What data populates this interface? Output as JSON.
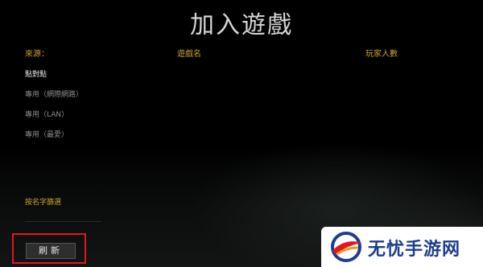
{
  "page": {
    "title": "加入遊戲"
  },
  "columns": {
    "source": "來源：",
    "game_name": "遊戲名",
    "players": "玩家人數"
  },
  "sources": [
    {
      "label": "點對點",
      "active": true
    },
    {
      "label": "專用（網際網路）",
      "active": false
    },
    {
      "label": "專用（LAN）",
      "active": false
    },
    {
      "label": "專用（最愛）",
      "active": false
    }
  ],
  "sort": {
    "label": "按名字篩選"
  },
  "actions": {
    "refresh_label": "刷新"
  },
  "watermark": {
    "text": "无忧手游网"
  },
  "colors": {
    "accent": "#c8a42a",
    "highlight_frame": "#e0191b",
    "watermark_blue": "#1c3d8f"
  }
}
